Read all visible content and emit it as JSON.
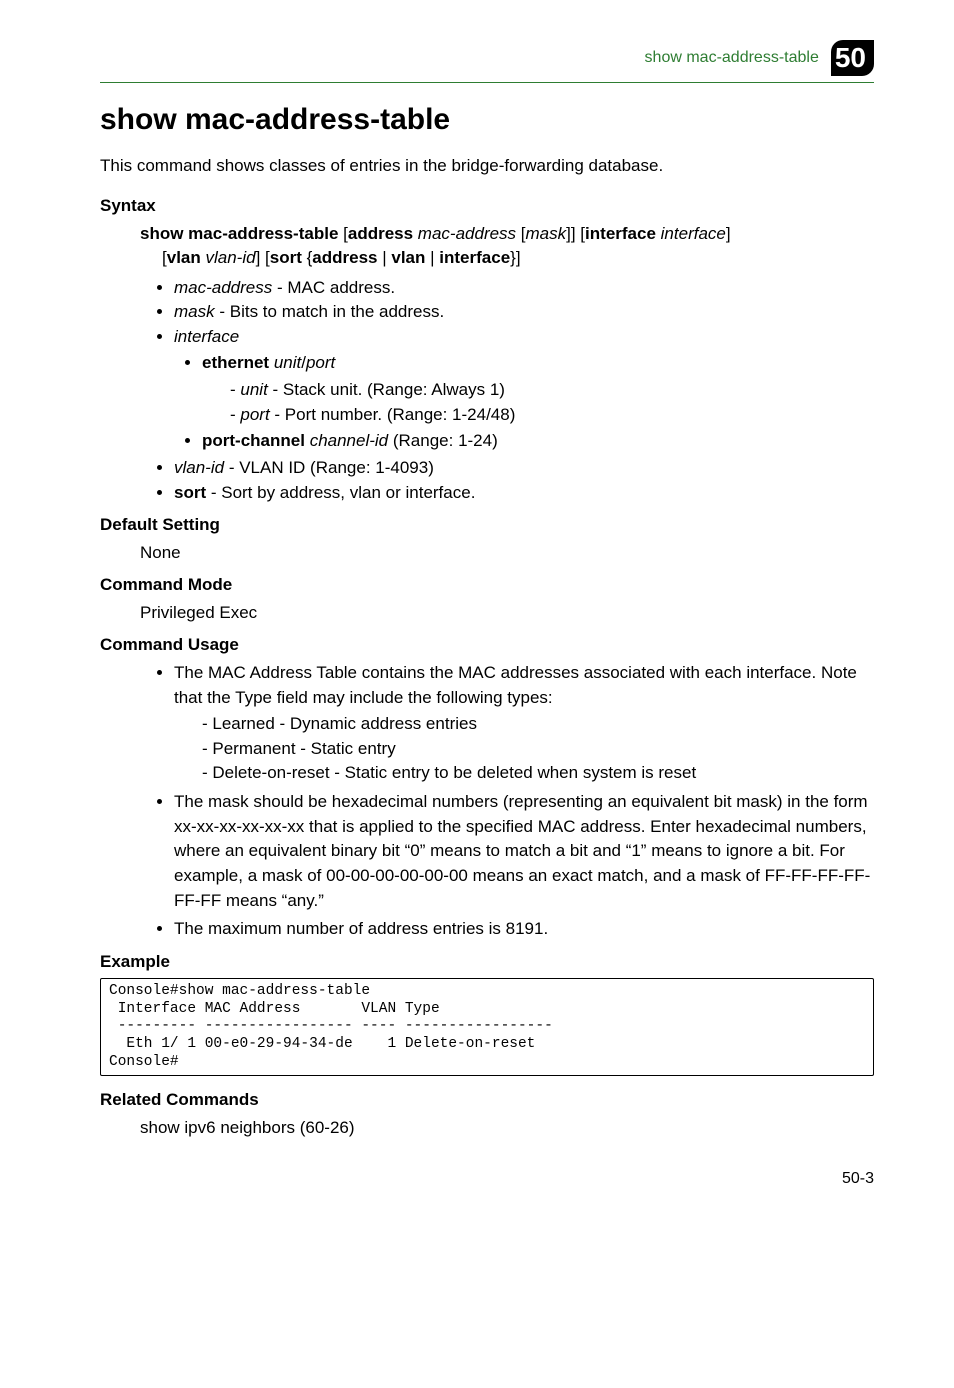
{
  "header": {
    "running": "show mac-address-table",
    "chapter": "50"
  },
  "title": "show mac-address-table",
  "intro": "This command shows classes of entries in the bridge-forwarding database.",
  "syntax": {
    "label": "Syntax",
    "cmd_b1": "show mac-address-table",
    "cmd_b2": "address",
    "cmd_i1": "mac-address",
    "cmd_i2": "mask",
    "cmd_b3": "interface",
    "cmd_i3": "interface",
    "cmd_b4": "vlan",
    "cmd_i4": "vlan-id",
    "cmd_b5": "sort",
    "cmd_b6": "address",
    "cmd_b7": "vlan",
    "cmd_b8": "interface",
    "params": {
      "mac_i": "mac-address",
      "mac_t": " - MAC address.",
      "mask_i": "mask",
      "mask_t": " - Bits to match in the address.",
      "iface_i": "interface",
      "eth_b": "ethernet",
      "eth_i": "unit",
      "eth_sep": "/",
      "eth_i2": "port",
      "unit_i": "unit",
      "unit_t": " - Stack unit. (Range: Always 1)",
      "port_i": "port",
      "port_t": " - Port number. (Range: 1-24/48)",
      "pc_b": "port-channel",
      "pc_i": "channel-id",
      "pc_t": " (Range: 1-24)",
      "vlan_i": "vlan-id",
      "vlan_t": " - VLAN ID (Range: 1-4093)",
      "sort_b": "sort",
      "sort_t": " - Sort by address, vlan or interface."
    }
  },
  "default": {
    "label": "Default Setting",
    "text": "None"
  },
  "mode": {
    "label": "Command Mode",
    "text": "Privileged Exec"
  },
  "usage": {
    "label": "Command Usage",
    "u1a": "The MAC Address Table contains the MAC addresses associated with each interface. Note that the Type field may include the following types:",
    "u1_d1": "Learned - Dynamic address entries",
    "u1_d2": "Permanent - Static entry",
    "u1_d3": "Delete-on-reset - Static entry to be deleted when system is reset",
    "u2": "The mask should be hexadecimal numbers (representing an equivalent bit mask) in the form xx-xx-xx-xx-xx-xx that is applied to the specified MAC address. Enter hexadecimal numbers, where an equivalent binary bit “0” means to match a bit and “1” means to ignore a bit. For example, a mask of 00-00-00-00-00-00 means an exact match, and a mask of FF-FF-FF-FF-FF-FF means “any.”",
    "u3": "The maximum number of address entries is 8191."
  },
  "example": {
    "label": "Example",
    "code": "Console#show mac-address-table\n Interface MAC Address       VLAN Type\n --------- ----------------- ---- -----------------\n  Eth 1/ 1 00-e0-29-94-34-de    1 Delete-on-reset\nConsole#"
  },
  "related": {
    "label": "Related Commands",
    "text": "show ipv6 neighbors (60-26)"
  },
  "footer": "50-3"
}
